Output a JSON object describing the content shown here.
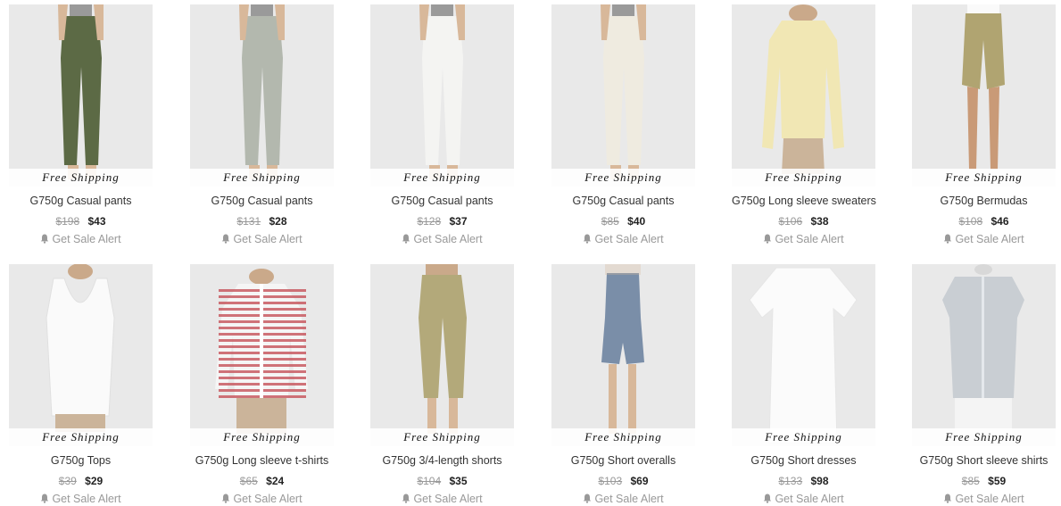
{
  "shipping_label": "Free Shipping",
  "alert_label": "Get Sale Alert",
  "colors": {
    "image_bg": "#e9e9e9",
    "price_old": "#999999",
    "price_new": "#222222"
  },
  "products": [
    {
      "brand": "G750g",
      "category": "Casual pants",
      "old_price": "$198",
      "price": "$43",
      "item_color": "#5c6a45",
      "icon": "pants-icon"
    },
    {
      "brand": "G750g",
      "category": "Casual pants",
      "old_price": "$131",
      "price": "$28",
      "item_color": "#b3b8ae",
      "icon": "pants-icon"
    },
    {
      "brand": "G750g",
      "category": "Casual pants",
      "old_price": "$128",
      "price": "$37",
      "item_color": "#f4f4f2",
      "icon": "pants-icon"
    },
    {
      "brand": "G750g",
      "category": "Casual pants",
      "old_price": "$85",
      "price": "$40",
      "item_color": "#efebe0",
      "icon": "pants-icon"
    },
    {
      "brand": "G750g",
      "category": "Long sleeve sweaters",
      "old_price": "$106",
      "price": "$38",
      "item_color": "#f1e7b4",
      "icon": "sweater-icon"
    },
    {
      "brand": "G750g",
      "category": "Bermudas",
      "old_price": "$108",
      "price": "$46",
      "item_color": "#b0a471",
      "icon": "shorts-icon"
    },
    {
      "brand": "G750g",
      "category": "Tops",
      "old_price": "$39",
      "price": "$29",
      "item_color": "#fafafa",
      "icon": "tank-top-icon"
    },
    {
      "brand": "G750g",
      "category": "Long sleeve t-shirts",
      "old_price": "$65",
      "price": "$24",
      "item_color": "#c85a62",
      "icon": "striped-cardigan-icon"
    },
    {
      "brand": "G750g",
      "category": "3/4-length shorts",
      "old_price": "$104",
      "price": "$35",
      "item_color": "#b3a97a",
      "icon": "capri-pants-icon"
    },
    {
      "brand": "G750g",
      "category": "Short overalls",
      "old_price": "$103",
      "price": "$69",
      "item_color": "#7a8ea8",
      "icon": "romper-icon"
    },
    {
      "brand": "G750g",
      "category": "Short dresses",
      "old_price": "$133",
      "price": "$98",
      "item_color": "#fbfbfb",
      "icon": "dress-icon"
    },
    {
      "brand": "G750g",
      "category": "Short sleeve shirts",
      "old_price": "$85",
      "price": "$59",
      "item_color": "#c9ced3",
      "icon": "shirt-icon"
    }
  ]
}
